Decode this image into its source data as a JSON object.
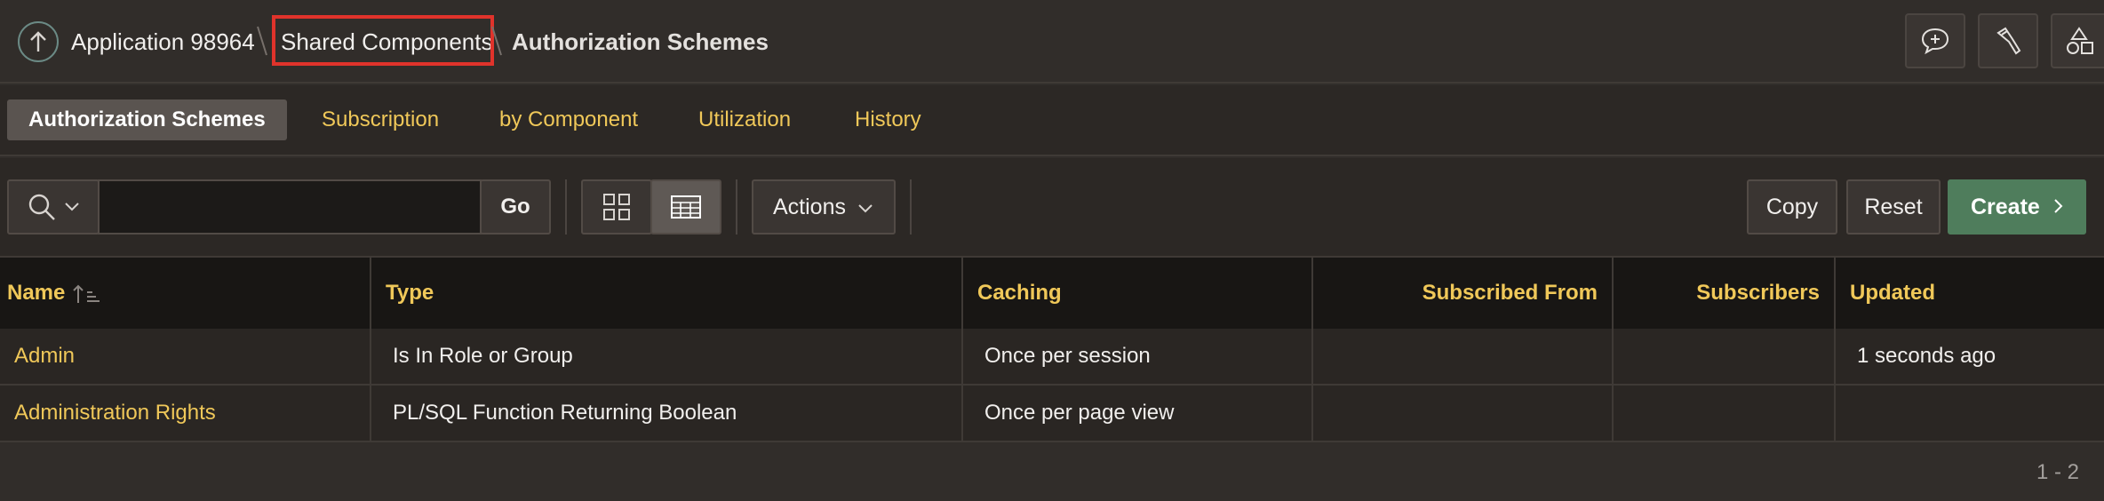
{
  "breadcrumb": {
    "app": "Application 98964",
    "shared": "Shared Components",
    "current": "Authorization Schemes"
  },
  "top_icons": [
    "comment-add-icon",
    "flashlight-icon",
    "shapes-icon"
  ],
  "tabs": [
    {
      "label": "Authorization Schemes",
      "active": true
    },
    {
      "label": "Subscription",
      "active": false
    },
    {
      "label": "by Component",
      "active": false
    },
    {
      "label": "Utilization",
      "active": false
    },
    {
      "label": "History",
      "active": false
    }
  ],
  "toolbar": {
    "search_value": "",
    "go_label": "Go",
    "actions_label": "Actions",
    "copy_label": "Copy",
    "reset_label": "Reset",
    "create_label": "Create"
  },
  "table": {
    "columns": [
      "Name",
      "Type",
      "Caching",
      "Subscribed From",
      "Subscribers",
      "Updated"
    ],
    "rows": [
      {
        "name": "Admin",
        "type": "Is In Role or Group",
        "caching": "Once per session",
        "subscribed_from": "",
        "subscribers": "",
        "updated": "1 seconds ago"
      },
      {
        "name": "Administration Rights",
        "type": "PL/SQL Function Returning Boolean",
        "caching": "Once per page view",
        "subscribed_from": "",
        "subscribers": "",
        "updated": ""
      }
    ],
    "pagination": "1 - 2"
  },
  "colors": {
    "accent_link": "#f0c859",
    "create": "#4f7d5c",
    "highlight": "#e0332b"
  }
}
